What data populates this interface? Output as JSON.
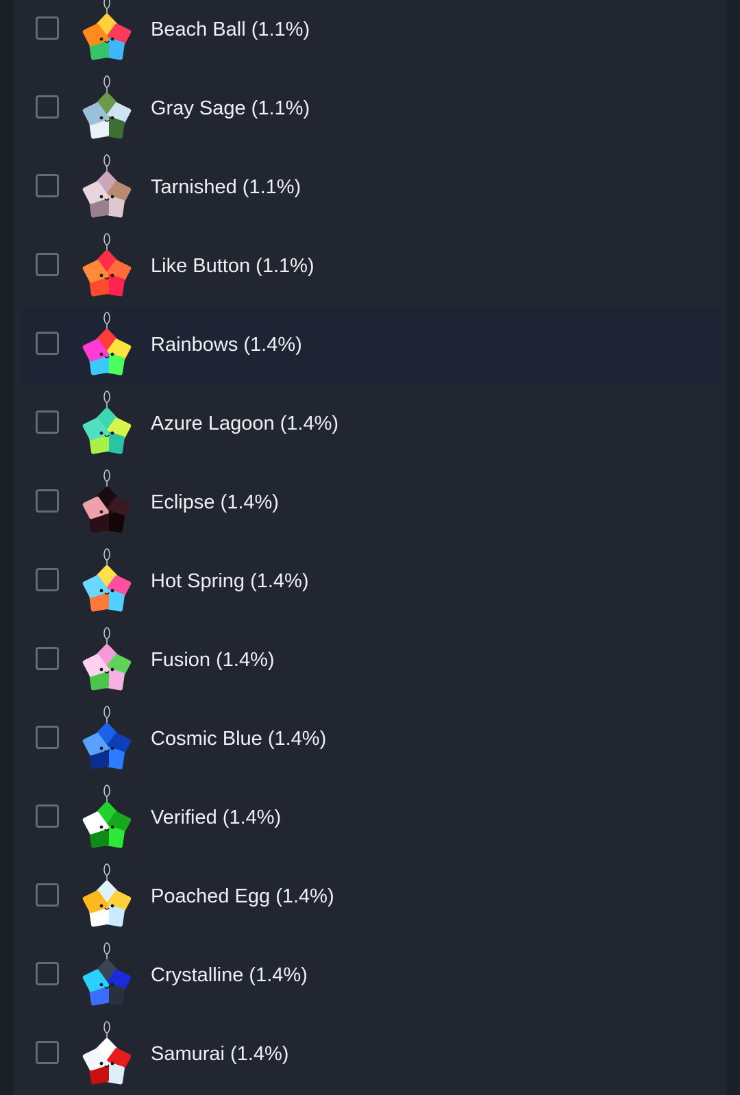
{
  "items": [
    {
      "label": "Beach Ball (1.1%)",
      "icon": "beach-ball-star-icon",
      "colors": [
        "#ffd23c",
        "#ff3b5c",
        "#3fb6ff",
        "#36c46b",
        "#ff8a1e"
      ]
    },
    {
      "label": "Gray Sage (1.1%)",
      "icon": "gray-sage-star-icon",
      "colors": [
        "#6b9a4a",
        "#cfe4f2",
        "#3f6e35",
        "#e8f2f8",
        "#9cc0d8"
      ]
    },
    {
      "label": "Tarnished (1.1%)",
      "icon": "tarnished-star-icon",
      "colors": [
        "#c9a6b8",
        "#b88a70",
        "#dcc8d0",
        "#9a7f8c",
        "#e7d6dc"
      ]
    },
    {
      "label": "Like Button (1.1%)",
      "icon": "like-button-star-icon",
      "colors": [
        "#ff2f45",
        "#ff6d3a",
        "#ff2450",
        "#ff4a2e",
        "#ff8a3a"
      ]
    },
    {
      "label": "Rainbows (1.4%)",
      "icon": "rainbows-star-icon",
      "colors": [
        "#ff3c3c",
        "#ffe33c",
        "#4dff5a",
        "#3cc9ff",
        "#ff3cd6"
      ]
    },
    {
      "label": "Azure Lagoon (1.4%)",
      "icon": "azure-lagoon-star-icon",
      "colors": [
        "#3fd6b4",
        "#d8f54a",
        "#29c4a6",
        "#a8f04a",
        "#50e0c0"
      ]
    },
    {
      "label": "Eclipse (1.4%)",
      "icon": "eclipse-star-icon",
      "colors": [
        "#1a0c10",
        "#3a1a20",
        "#120608",
        "#2a1014",
        "#f0a0a8"
      ]
    },
    {
      "label": "Hot Spring (1.4%)",
      "icon": "hot-spring-star-icon",
      "colors": [
        "#ffe24a",
        "#ff4fa0",
        "#4fd0ff",
        "#ff7a3a",
        "#6ad8ff"
      ]
    },
    {
      "label": "Fusion (1.4%)",
      "icon": "fusion-star-icon",
      "colors": [
        "#f49ad8",
        "#5ed35a",
        "#f7b0e4",
        "#4cc64a",
        "#ffd0f0"
      ]
    },
    {
      "label": "Cosmic Blue (1.4%)",
      "icon": "cosmic-blue-star-icon",
      "colors": [
        "#1d63e8",
        "#0f3fb8",
        "#2c7cff",
        "#0a2f90",
        "#5aa0ff"
      ]
    },
    {
      "label": "Verified (1.4%)",
      "icon": "verified-star-icon",
      "colors": [
        "#23d02c",
        "#16a81e",
        "#2ee838",
        "#0f8c16",
        "#ffffff"
      ]
    },
    {
      "label": "Poached Egg (1.4%)",
      "icon": "poached-egg-star-icon",
      "colors": [
        "#dff3ff",
        "#ffd23a",
        "#c8ebff",
        "#ffffff",
        "#ffb81e"
      ]
    },
    {
      "label": "Crystalline (1.4%)",
      "icon": "crystalline-star-icon",
      "colors": [
        "#3a4452",
        "#1c2bd8",
        "#28323e",
        "#3b6dff",
        "#2ad0ff"
      ]
    },
    {
      "label": "Samurai (1.4%)",
      "icon": "samurai-star-icon",
      "colors": [
        "#ffffff",
        "#e81c1c",
        "#dceefa",
        "#c81010",
        "#f4f8fc"
      ]
    }
  ],
  "highlighted_index": 4,
  "colors": {
    "page_background": "#1b1f26",
    "panel_background": "#222631",
    "highlight_row": "#1e2433",
    "checkbox_border": "#666a73",
    "label_text": "#eef0f4"
  }
}
